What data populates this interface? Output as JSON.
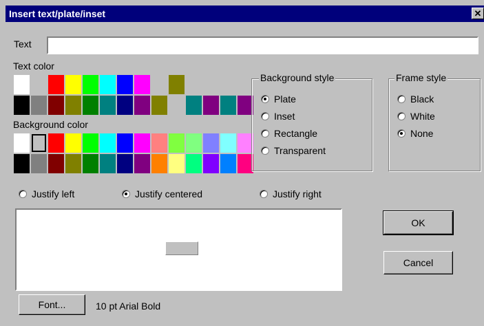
{
  "window": {
    "title": "Insert text/plate/inset",
    "close_glyph": "✕"
  },
  "text_field": {
    "label": "Text",
    "value": ""
  },
  "text_color": {
    "label": "Text color",
    "rows": [
      [
        "#ffffff",
        "#c0c0c0",
        "#ff0000",
        "#ffff00",
        "#00ff00",
        "#00ffff",
        "#0000ff",
        "#ff00ff",
        "#c0c0c0",
        "#808000",
        "#c0c0c0",
        "#c0c0c0",
        "#c0c0c0",
        "#c0c0c0"
      ],
      [
        "#000000",
        "#808080",
        "#800000",
        "#808000",
        "#008000",
        "#008080",
        "#000080",
        "#800080",
        "#808000",
        "#c0c0c0",
        "#008080",
        "#800080",
        "#008080",
        "#800080"
      ]
    ]
  },
  "background_color": {
    "label": "Background color",
    "selected": [
      0,
      1
    ],
    "rows": [
      [
        "#ffffff",
        "#c0c0c0",
        "#ff0000",
        "#ffff00",
        "#00ff00",
        "#00ffff",
        "#0000ff",
        "#ff00ff",
        "#ff8080",
        "#80ff40",
        "#80ff80",
        "#8080ff",
        "#80ffff",
        "#ff80ff"
      ],
      [
        "#000000",
        "#808080",
        "#800000",
        "#808000",
        "#008000",
        "#008080",
        "#000080",
        "#800080",
        "#ff8000",
        "#ffff80",
        "#00ff80",
        "#8000ff",
        "#0080ff",
        "#ff0080"
      ]
    ]
  },
  "background_style": {
    "label": "Background style",
    "options": [
      "Plate",
      "Inset",
      "Rectangle",
      "Transparent"
    ],
    "selected": "Plate"
  },
  "frame_style": {
    "label": "Frame style",
    "options": [
      "Black",
      "White",
      "None"
    ],
    "selected": "None"
  },
  "justify": {
    "options": [
      "Justify left",
      "Justify centered",
      "Justify right"
    ],
    "selected": "Justify centered"
  },
  "buttons": {
    "ok": "OK",
    "cancel": "Cancel",
    "font": "Font..."
  },
  "font_description": "10 pt Arial Bold",
  "icons": {
    "close": "close-icon",
    "radio": "radio-button"
  }
}
